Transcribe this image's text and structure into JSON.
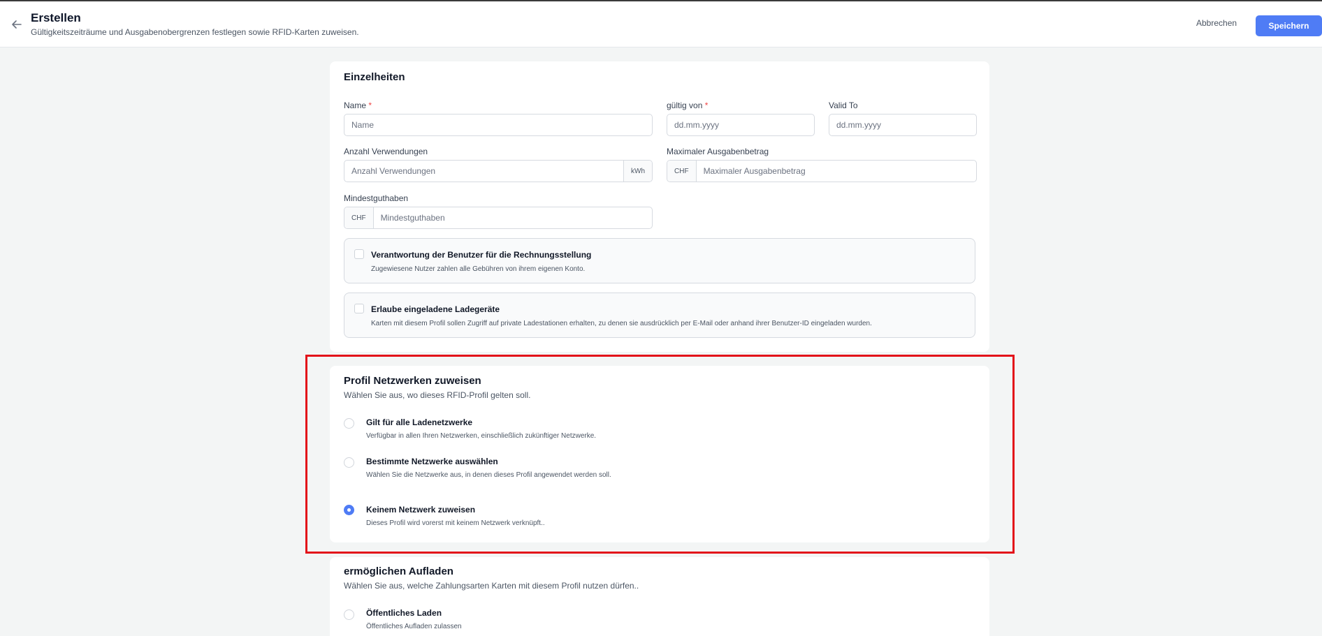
{
  "header": {
    "title": "Erstellen",
    "subtitle": "Gültigkeitszeiträume und Ausgabenobergrenzen festlegen sowie RFID-Karten zuweisen.",
    "cancel_label": "Abbrechen",
    "save_label": "Speichern"
  },
  "details": {
    "title": "Einzelheiten",
    "required_mark": "*",
    "name": {
      "label": "Name",
      "placeholder": "Name"
    },
    "valid_from": {
      "label": "gültig von",
      "placeholder": "dd.mm.yyyy"
    },
    "valid_to": {
      "label": "Valid To",
      "placeholder": "dd.mm.yyyy"
    },
    "usage_count": {
      "label": "Anzahl Verwendungen",
      "placeholder": "Anzahl Verwendungen",
      "unit": "kWh"
    },
    "max_spend": {
      "label": "Maximaler Ausgabenbetrag",
      "placeholder": "Maximaler Ausgabenbetrag",
      "currency": "CHF"
    },
    "min_balance": {
      "label": "Mindestguthaben",
      "placeholder": "Mindestguthaben",
      "currency": "CHF"
    },
    "billing_option": {
      "title": "Verantwortung der Benutzer für die Rechnungsstellung",
      "description": "Zugewiesene Nutzer zahlen alle Gebühren von ihrem eigenen Konto."
    },
    "invited_option": {
      "title": "Erlaube eingeladene Ladegeräte",
      "description": "Karten mit diesem Profil sollen Zugriff auf private Ladestationen erhalten, zu denen sie ausdrücklich per E-Mail oder anhand ihrer Benutzer-ID eingeladen wurden."
    }
  },
  "networks": {
    "title": "Profil Netzwerken zuweisen",
    "subtitle": "Wählen Sie aus, wo dieses RFID-Profil gelten soll.",
    "options": [
      {
        "title": "Gilt für alle Ladenetzwerke",
        "description": "Verfügbar in allen Ihren Netzwerken, einschließlich zukünftiger Netzwerke."
      },
      {
        "title": "Bestimmte Netzwerke auswählen",
        "description": "Wählen Sie die Netzwerke aus, in denen dieses Profil angewendet werden soll."
      },
      {
        "title": "Keinem Netzwerk zuweisen",
        "description": "Dieses Profil wird vorerst mit keinem Netzwerk verknüpft.."
      }
    ],
    "selected": "Keinem Netzwerk zuweisen"
  },
  "charging": {
    "title": "ermöglichen Aufladen",
    "subtitle": "Wählen Sie aus, welche Zahlungsarten Karten mit diesem Profil nutzen dürfen..",
    "options": [
      {
        "title": "Öffentliches Laden",
        "description": "Öffentliches Aufladen zulassen"
      }
    ]
  },
  "colors": {
    "accent": "#4f7cf5",
    "highlight": "#e3131a",
    "required": "#ef4444"
  }
}
